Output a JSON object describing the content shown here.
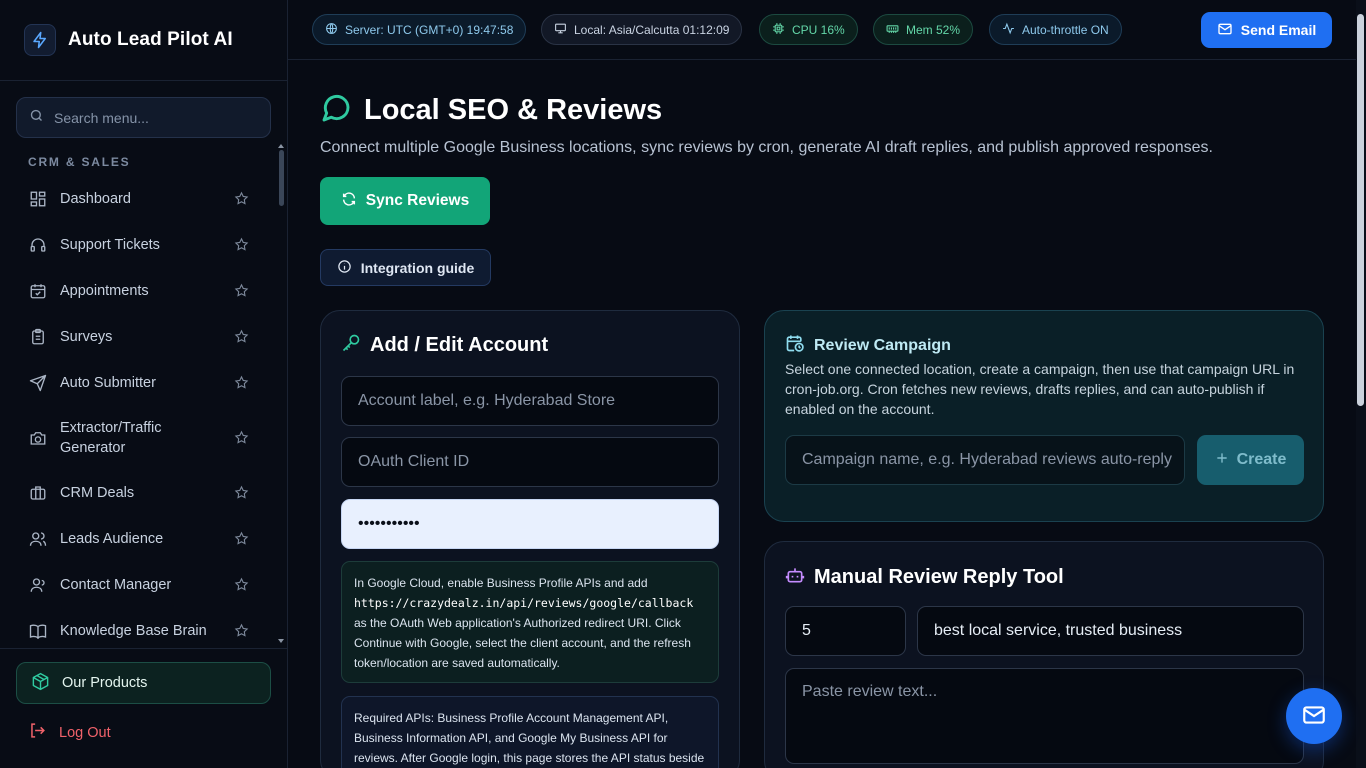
{
  "brand": {
    "title": "Auto Lead Pilot AI"
  },
  "search": {
    "placeholder": "Search menu..."
  },
  "sidebar": {
    "section_label": "CRM & SALES",
    "items": [
      {
        "label": "Dashboard",
        "icon": "dashboard-icon"
      },
      {
        "label": "Support Tickets",
        "icon": "headset-icon"
      },
      {
        "label": "Appointments",
        "icon": "calendar-check-icon"
      },
      {
        "label": "Surveys",
        "icon": "clipboard-icon"
      },
      {
        "label": "Auto Submitter",
        "icon": "send-icon"
      },
      {
        "label": "Extractor/Traffic Generator",
        "icon": "camera-icon"
      },
      {
        "label": "CRM Deals",
        "icon": "briefcase-icon"
      },
      {
        "label": "Leads Audience",
        "icon": "users-icon"
      },
      {
        "label": "Contact Manager",
        "icon": "user-icon"
      },
      {
        "label": "Knowledge Base Brain",
        "icon": "book-icon"
      }
    ],
    "products_label": "Our Products",
    "logout_label": "Log Out"
  },
  "topbar": {
    "server": "Server: UTC (GMT+0) 19:47:58",
    "local": "Local: Asia/Calcutta 01:12:09",
    "cpu": "CPU 16%",
    "mem": "Mem 52%",
    "throttle": "Auto-throttle ON",
    "send_email_label": "Send Email"
  },
  "page": {
    "title": "Local SEO & Reviews",
    "subtitle": "Connect multiple Google Business locations, sync reviews by cron, generate AI draft replies, and publish approved responses.",
    "sync_label": "Sync Reviews",
    "guide_label": "Integration guide"
  },
  "account": {
    "title": "Add / Edit Account",
    "label_placeholder": "Account label, e.g. Hyderabad Store",
    "client_id_placeholder": "OAuth Client ID",
    "secret_value": "•••••••••••",
    "note_green_1": "In Google Cloud, enable Business Profile APIs and add",
    "note_green_url": "https://crazydealz.in/api/reviews/google/callback",
    "note_green_2": "as the OAuth Web application's Authorized redirect URI. Click Continue with Google, select the client account, and the refresh token/location are saved automatically.",
    "note_blue": "Required APIs: Business Profile Account Management API, Business Information API, and Google My Business API for reviews. After Google login, this page stores the API status beside"
  },
  "campaign": {
    "title": "Review Campaign",
    "description": "Select one connected location, create a campaign, then use that campaign URL in cron-job.org. Cron fetches new reviews, drafts replies, and can auto-publish if enabled on the account.",
    "name_placeholder": "Campaign name, e.g. Hyderabad reviews auto-reply",
    "create_label": "Create"
  },
  "manual": {
    "title": "Manual Review Reply Tool",
    "rating_value": "5",
    "keywords_value": "best local service, trusted business",
    "review_placeholder": "Paste review text..."
  },
  "colors": {
    "accent_green": "#12a578",
    "accent_blue": "#1f6ff2",
    "danger": "#f0626a"
  }
}
